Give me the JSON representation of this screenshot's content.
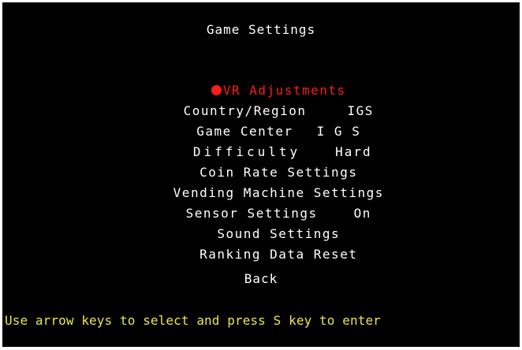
{
  "screen": {
    "title": "Game Settings",
    "menu": [
      {
        "label": "VR Adjustments",
        "value": "",
        "selected": true
      },
      {
        "label": "Country/Region",
        "value": "IGS",
        "selected": false
      },
      {
        "label": "Game Center",
        "value": "I G S",
        "selected": false
      },
      {
        "label": "Difficulty",
        "value": "Hard",
        "selected": false
      },
      {
        "label": "Coin Rate Settings",
        "value": "",
        "selected": false
      },
      {
        "label": "Vending Machine Settings",
        "value": "",
        "selected": false
      },
      {
        "label": "Sensor Settings",
        "value": "On",
        "selected": false
      },
      {
        "label": "Sound Settings",
        "value": "",
        "selected": false
      },
      {
        "label": "Ranking Data Reset",
        "value": "",
        "selected": false
      }
    ],
    "back_label": "Back",
    "footer": "Use arrow keys to select and press S key to enter"
  },
  "colors": {
    "background": "#000000",
    "text": "#ffffff",
    "selected": "#ff1a1a",
    "footer": "#e8e84a"
  }
}
